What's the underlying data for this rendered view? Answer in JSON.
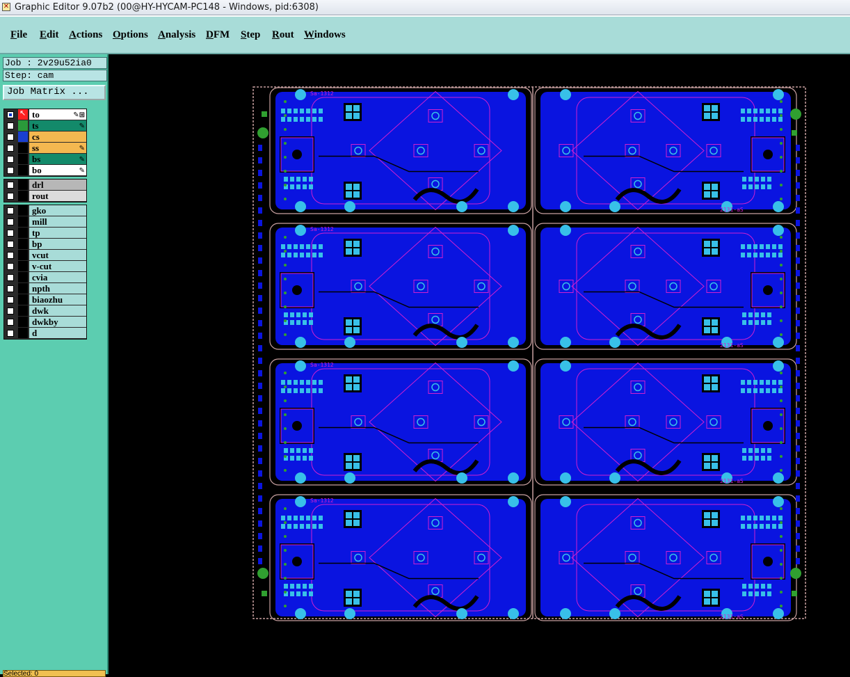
{
  "window": {
    "title": "Graphic Editor 9.07b2 (00@HY-HYCAM-PC148 - Windows, pid:6308)"
  },
  "menu": [
    {
      "label": "File",
      "accel": "F",
      "rest": "ile"
    },
    {
      "label": "Edit",
      "accel": "E",
      "rest": "dit"
    },
    {
      "label": "Actions",
      "accel": "A",
      "rest": "ctions"
    },
    {
      "label": "Options",
      "accel": "O",
      "rest": "ptions"
    },
    {
      "label": "Analysis",
      "accel": "A",
      "rest": "nalysis"
    },
    {
      "label": "DFM",
      "accel": "D",
      "rest": "FM"
    },
    {
      "label": "Step",
      "accel": "S",
      "rest": "tep"
    },
    {
      "label": "Rout",
      "accel": "R",
      "rest": "out"
    },
    {
      "label": "Windows",
      "accel": "W",
      "rest": "indows"
    }
  ],
  "job": {
    "label": "Job : 2v29u52ia0"
  },
  "step": {
    "label": "Step: cam"
  },
  "job_matrix_button": "Job Matrix ...",
  "layers_signal": [
    {
      "name": "to",
      "bg": "#ffffff",
      "swatch": "#ff2020",
      "checked": true,
      "mark": "✎⊞"
    },
    {
      "name": "ts",
      "bg": "#138a6a",
      "swatch": "#2a9a3a",
      "checked": false,
      "mark": "✎"
    },
    {
      "name": "cs",
      "bg": "#f4b850",
      "swatch": "#1a3fd0",
      "checked": false,
      "mark": ""
    },
    {
      "name": "ss",
      "bg": "#f4b850",
      "swatch": "#000000",
      "checked": false,
      "mark": "✎"
    },
    {
      "name": "bs",
      "bg": "#138a6a",
      "swatch": "#000000",
      "checked": false,
      "mark": "✎"
    },
    {
      "name": "bo",
      "bg": "#ffffff",
      "swatch": "#000000",
      "checked": false,
      "mark": "✎"
    }
  ],
  "layers_drill": [
    {
      "name": "drl",
      "bg": "#b7b7b7"
    },
    {
      "name": "rout",
      "bg": "#dcdcdc"
    }
  ],
  "layers_misc": [
    {
      "name": "gko"
    },
    {
      "name": "mill"
    },
    {
      "name": "tp"
    },
    {
      "name": "bp"
    },
    {
      "name": "vcut"
    },
    {
      "name": "v-cut"
    },
    {
      "name": "cvia"
    },
    {
      "name": "npth"
    },
    {
      "name": "biaozhu"
    },
    {
      "name": "dwk"
    },
    {
      "name": "dwkby"
    },
    {
      "name": "d"
    }
  ],
  "misc_bg": "#a8dcd8",
  "status": {
    "selected": "Selected: 0"
  },
  "board": {
    "silk_label": "Sa-1312",
    "colors": {
      "copper": "#0a14e0",
      "pad": "#38c0e8",
      "silk": "#d020d0",
      "outline": "#c8a0a0",
      "mark": "#30a030"
    }
  }
}
